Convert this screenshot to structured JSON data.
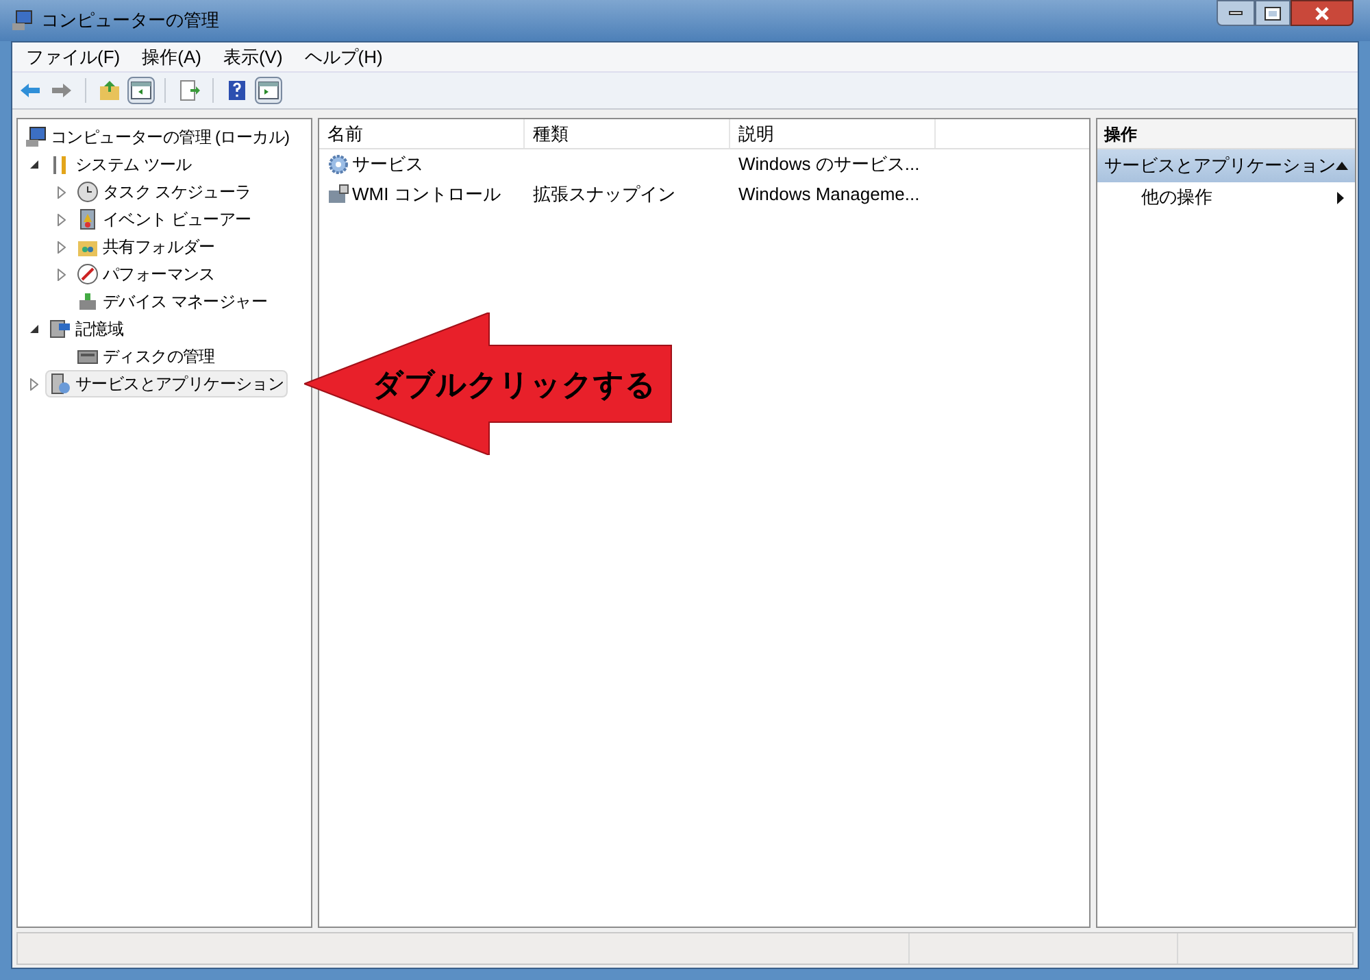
{
  "window": {
    "title": "コンピューターの管理"
  },
  "menu": [
    "ファイル(F)",
    "操作(A)",
    "表示(V)",
    "ヘルプ(H)"
  ],
  "toolbar": [
    {
      "kind": "back",
      "disabled": false
    },
    {
      "kind": "forward",
      "disabled": true
    },
    {
      "kind": "sep"
    },
    {
      "kind": "up"
    },
    {
      "kind": "pane-left",
      "selected": true
    },
    {
      "kind": "sep"
    },
    {
      "kind": "export"
    },
    {
      "kind": "sep"
    },
    {
      "kind": "help"
    },
    {
      "kind": "pane-right",
      "selected": true
    }
  ],
  "tree": [
    {
      "label": "コンピューターの管理 (ローカル)",
      "selected": false,
      "children": [
        {
          "label": "システム ツール",
          "expanded": true,
          "selected": false,
          "children": [
            {
              "label": "タスク スケジューラ",
              "expanded": false,
              "selected": false
            },
            {
              "label": "イベント ビューアー",
              "expanded": false,
              "selected": false
            },
            {
              "label": "共有フォルダー",
              "expanded": false,
              "selected": false
            },
            {
              "label": "パフォーマンス",
              "expanded": false,
              "selected": false
            },
            {
              "label": "デバイス マネージャー",
              "selected": false
            }
          ]
        },
        {
          "label": "記憶域",
          "expanded": true,
          "selected": false,
          "children": [
            {
              "label": "ディスクの管理",
              "selected": false
            }
          ]
        },
        {
          "label": "サービスとアプリケーション",
          "expanded": false,
          "selected": true
        }
      ]
    }
  ],
  "table": {
    "columns": [
      "名前",
      "種類",
      "説明"
    ],
    "rows": [
      {
        "cells": [
          "サービス",
          "",
          "Windows のサービス..."
        ]
      },
      {
        "cells": [
          "WMI コントロール",
          "拡張スナップイン",
          "Windows Manageme..."
        ]
      }
    ]
  },
  "actions": {
    "title": "操作",
    "section": "サービスとアプリケーション",
    "items": [
      "他の操作"
    ]
  },
  "annotation": {
    "text": "ダブルクリックする"
  }
}
